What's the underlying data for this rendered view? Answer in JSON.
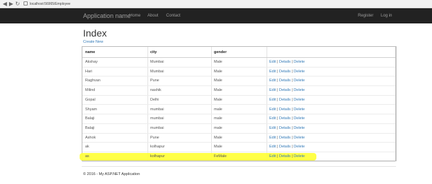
{
  "browser": {
    "url": "localhost:56965/Employee"
  },
  "navbar": {
    "brand": "Application name",
    "links": [
      "Home",
      "About",
      "Contact"
    ],
    "right_links": [
      "Register",
      "Log in"
    ]
  },
  "page": {
    "title": "Index",
    "create_new": "Create New"
  },
  "table": {
    "headers": [
      "name",
      "city",
      "gender",
      ""
    ],
    "rows": [
      {
        "name": "Akshay",
        "city": "Mumbai",
        "gender": "Male"
      },
      {
        "name": "Hari",
        "city": "Mumbai",
        "gender": "Male"
      },
      {
        "name": "Raghvan",
        "city": "Pune",
        "gender": "Male"
      },
      {
        "name": "Milind",
        "city": "nashik",
        "gender": "Male"
      },
      {
        "name": "Gopal",
        "city": "Delhi",
        "gender": "Male"
      },
      {
        "name": "Shyam",
        "city": "mumbai",
        "gender": "male"
      },
      {
        "name": "Balaji",
        "city": "mumbai",
        "gender": "male"
      },
      {
        "name": "Balaji",
        "city": "mumbai",
        "gender": "male"
      },
      {
        "name": "Ashok",
        "city": "Pune",
        "gender": "Male"
      },
      {
        "name": "ak",
        "city": "kolhapur",
        "gender": "Male"
      },
      {
        "name": "as",
        "city": "kolhapur",
        "gender": "FeMale"
      }
    ],
    "actions": {
      "edit": "Edit",
      "details": "Details",
      "delete": "Delete",
      "separator": "|"
    },
    "highlight_color": "#ffff33"
  },
  "footer": {
    "text": "© 2016 - My ASP.NET Application"
  },
  "colors": {
    "navbar_bg": "#222222",
    "link": "#337ab7"
  }
}
